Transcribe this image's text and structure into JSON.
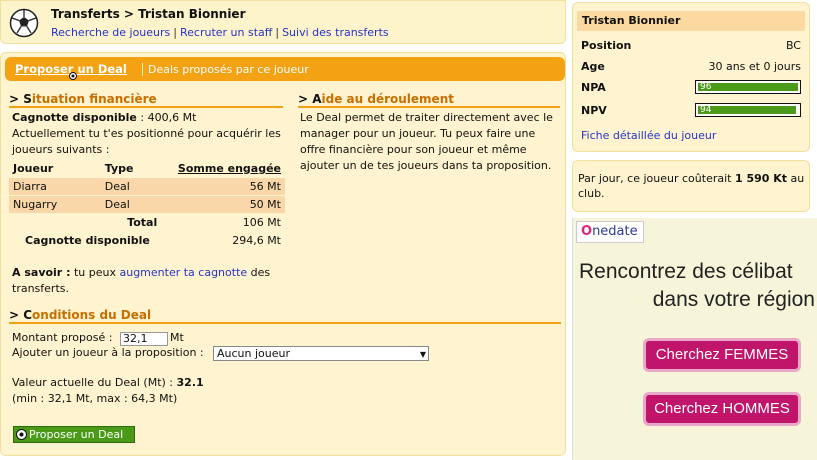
{
  "header": {
    "title": "Transferts > Tristan Bionnier",
    "links": [
      "Recherche de joueurs",
      "Recruter un staff",
      "Suivi des transferts"
    ]
  },
  "tabs": {
    "active": "Proposer un Deal",
    "other": "Deals proposés par ce joueur"
  },
  "finance": {
    "title_first": "S",
    "title_rest": "ituation financière",
    "cagnotte_label": "Cagnotte disponible",
    "cagnotte_value": ": 400,6 Mt",
    "intro": "Actuellement tu t'es positionné pour acquérir les joueurs suivants :",
    "columns": [
      "Joueur",
      "Type",
      "Somme engagée"
    ],
    "rows": [
      {
        "player": "Diarra",
        "type": "Deal",
        "amount": "56 Mt"
      },
      {
        "player": "Nugarry",
        "type": "Deal",
        "amount": "50 Mt"
      }
    ],
    "total_label": "Total",
    "total_value": "106 Mt",
    "available_label": "Cagnotte disponible",
    "available_value": "294,6 Mt",
    "know_label": "A savoir :",
    "know_text": " tu peux ",
    "know_link": "augmenter ta cagnotte",
    "know_tail": " des transferts."
  },
  "help": {
    "title_first": "A",
    "title_rest": "ide au déroulement",
    "text": "Le Deal permet de traiter directement avec le manager pour un joueur. Tu peux faire une offre financière pour son joueur et même ajouter un de tes joueurs dans ta proposition."
  },
  "conditions": {
    "title_first": "C",
    "title_rest": "onditions du Deal",
    "amount_label": "Montant proposé :",
    "amount_value": "32,1",
    "amount_unit": "Mt",
    "add_label": "Ajouter un joueur à la proposition :",
    "add_select": "Aucun joueur",
    "current_label": "Valeur actuelle du Deal (Mt) :",
    "current_value": "32.1",
    "range": "(min : 32,1 Mt, max : 64,3 Mt)",
    "submit": "Proposer un Deal"
  },
  "player": {
    "name": "Tristan Bionnier",
    "position_label": "Position",
    "position_value": "BC",
    "age_label": "Age",
    "age_value": "30 ans et 0 jours",
    "npa_label": "NPA",
    "npa_value": "96",
    "npa_fraction": 0.96,
    "npv_label": "NPV",
    "npv_value": "94",
    "npv_fraction": 0.94,
    "detail_link": "Fiche détaillée du joueur",
    "cost_pre": "Par jour, ce joueur coûterait ",
    "cost_value": "1 590 Kt",
    "cost_post": " au club."
  },
  "ad": {
    "logo": "nedate",
    "logo_mark": "O",
    "line1": "Rencontrez des célibat",
    "line2": "dans votre région",
    "btn_women": "Cherchez FEMMES",
    "btn_men": "Cherchez HOMMES"
  },
  "colors": {
    "accent": "#f3a214",
    "section_title": "#c86d00",
    "bar_green": "#4c9a19",
    "ad_button": "#c0156b"
  }
}
